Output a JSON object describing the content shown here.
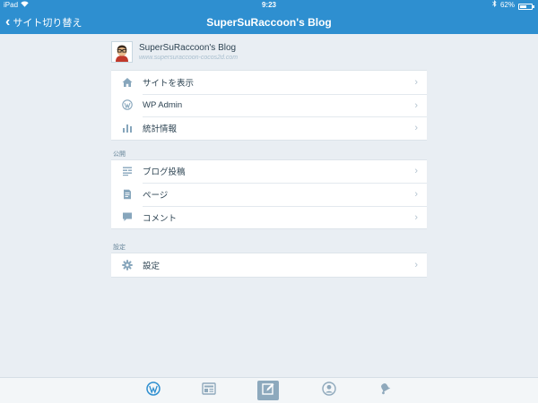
{
  "status_bar": {
    "device": "iPad",
    "time": "9:23",
    "battery": "62%",
    "battery_level": 0.62
  },
  "nav": {
    "back_label": "サイト切り替え",
    "title": "SuperSuRaccoon's Blog"
  },
  "site": {
    "name": "SuperSuRaccoon's Blog",
    "url": "www.supersuraccoon-cocos2d.com"
  },
  "menu_main": [
    {
      "label": "サイトを表示",
      "icon": "home-icon"
    },
    {
      "label": "WP Admin",
      "icon": "wordpress-icon"
    },
    {
      "label": "統計情報",
      "icon": "stats-icon"
    }
  ],
  "section_publish": {
    "title": "公開",
    "items": [
      {
        "label": "ブログ投稿",
        "icon": "posts-icon"
      },
      {
        "label": "ページ",
        "icon": "page-icon"
      },
      {
        "label": "コメント",
        "icon": "comment-icon"
      }
    ]
  },
  "section_settings": {
    "title": "設定",
    "items": [
      {
        "label": "設定",
        "icon": "gear-icon"
      }
    ]
  },
  "tabbar": {
    "items": [
      "my-sites-icon",
      "reader-icon",
      "compose-icon",
      "profile-icon",
      "notifications-icon"
    ],
    "selected": "compose-icon"
  },
  "colors": {
    "brand_blue": "#2e8fd0",
    "background": "#e9eef3",
    "icon_gray": "#87a6bc"
  }
}
